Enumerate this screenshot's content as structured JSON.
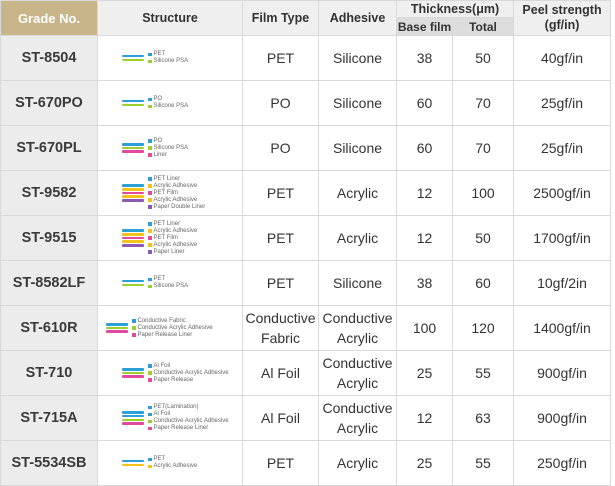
{
  "header": {
    "grade": "Grade No.",
    "structure": "Structure",
    "film_type": "Film Type",
    "adhesive": "Adhesive",
    "thickness": "Thickness(μm)",
    "base_film": "Base film",
    "total": "Total",
    "peel_line1": "Peel strength",
    "peel_line2": "(gf/in)"
  },
  "colors": {
    "PET": "#2b9fd6",
    "Silicone PSA": "#9ccf2f",
    "PO": "#2b9fd6",
    "Liner": "#e14b9d",
    "PET Liner": "#2b9fd6",
    "Acrylic Adhesive": "#f4c319",
    "PET Film": "#e14b9d",
    "Paper Double Liner": "#8a5bb0",
    "Paper Liner": "#8a5bb0",
    "Conductive Fabric": "#2b9fd6",
    "Conductive Acrylic Adhesive": "#9ccf2f",
    "Paper Release Liner": "#e14b9d",
    "Al Foil": "#2b9fd6",
    "Paper Release": "#e14b9d",
    "PET(Lamination)": "#2b9fd6"
  },
  "rows": [
    {
      "grade": "ST-8504",
      "layers": [
        "PET",
        "Silicone PSA"
      ],
      "film_type": "PET",
      "film_type_2": "",
      "adhesive": "Silicone",
      "adhesive_2": "",
      "base": "38",
      "total": "50",
      "peel": "40gf/in"
    },
    {
      "grade": "ST-670PO",
      "layers": [
        "PO",
        "Silicone PSA"
      ],
      "film_type": "PO",
      "film_type_2": "",
      "adhesive": "Silicone",
      "adhesive_2": "",
      "base": "60",
      "total": "70",
      "peel": "25gf/in"
    },
    {
      "grade": "ST-670PL",
      "layers": [
        "PO",
        "Silicone PSA",
        "Liner"
      ],
      "film_type": "PO",
      "film_type_2": "",
      "adhesive": "Silicone",
      "adhesive_2": "",
      "base": "60",
      "total": "70",
      "peel": "25gf/in"
    },
    {
      "grade": "ST-9582",
      "layers": [
        "PET Liner",
        "Acrylic Adhesive",
        "PET Film",
        "Acrylic Adhesive",
        "Paper Double Liner"
      ],
      "film_type": "PET",
      "film_type_2": "",
      "adhesive": "Acrylic",
      "adhesive_2": "",
      "base": "12",
      "total": "100",
      "peel": "2500gf/in"
    },
    {
      "grade": "ST-9515",
      "layers": [
        "PET Liner",
        "Acrylic Adhesive",
        "PET Film",
        "Acrylic Adhesive",
        "Paper Liner"
      ],
      "film_type": "PET",
      "film_type_2": "",
      "adhesive": "Acrylic",
      "adhesive_2": "",
      "base": "12",
      "total": "50",
      "peel": "1700gf/in"
    },
    {
      "grade": "ST-8582LF",
      "layers": [
        "PET",
        "Silicone PSA"
      ],
      "film_type": "PET",
      "film_type_2": "",
      "adhesive": "Silicone",
      "adhesive_2": "",
      "base": "38",
      "total": "60",
      "peel": "10gf/2in"
    },
    {
      "grade": "ST-610R",
      "layers": [
        "Conductive Fabric",
        "Conductive Acrylic Adhesive",
        "Paper Release Liner"
      ],
      "film_type": "Conductive",
      "film_type_2": "Fabric",
      "adhesive": "Conductive",
      "adhesive_2": "Acrylic",
      "base": "100",
      "total": "120",
      "peel": "1400gf/in"
    },
    {
      "grade": "ST-710",
      "layers": [
        "Al Foil",
        "Conductive Acrylic Adhesive",
        "Paper Release"
      ],
      "film_type": "Al Foil",
      "film_type_2": "",
      "adhesive": "Conductive",
      "adhesive_2": "Acrylic",
      "base": "25",
      "total": "55",
      "peel": "900gf/in"
    },
    {
      "grade": "ST-715A",
      "layers": [
        "PET(Lamination)",
        "Al Foil",
        "Conductive Acrylic Adhesive",
        "Paper Release Liner"
      ],
      "film_type": "Al Foil",
      "film_type_2": "",
      "adhesive": "Conductive",
      "adhesive_2": "Acrylic",
      "base": "12",
      "total": "63",
      "peel": "900gf/in"
    },
    {
      "grade": "ST-5534SB",
      "layers": [
        "PET",
        "Acrylic Adhesive"
      ],
      "film_type": "PET",
      "film_type_2": "",
      "adhesive": "Acrylic",
      "adhesive_2": "",
      "base": "25",
      "total": "55",
      "peel": "250gf/in"
    }
  ]
}
